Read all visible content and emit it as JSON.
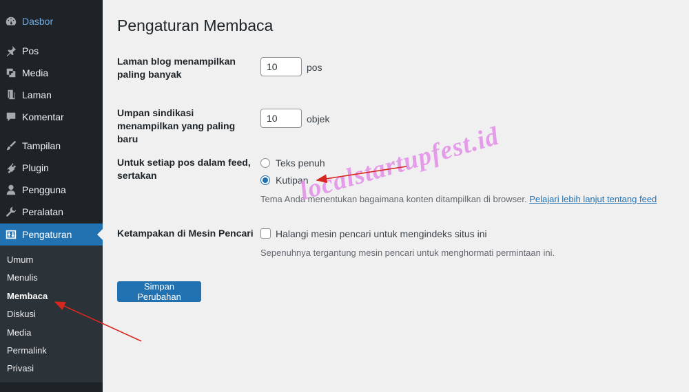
{
  "sidebar": {
    "items": [
      {
        "label": "Dasbor",
        "icon": "dashboard-icon"
      },
      {
        "label": "Pos",
        "icon": "pin-icon"
      },
      {
        "label": "Media",
        "icon": "media-icon"
      },
      {
        "label": "Laman",
        "icon": "page-icon"
      },
      {
        "label": "Komentar",
        "icon": "comment-icon"
      },
      {
        "label": "Tampilan",
        "icon": "brush-icon"
      },
      {
        "label": "Plugin",
        "icon": "plugin-icon"
      },
      {
        "label": "Pengguna",
        "icon": "user-icon"
      },
      {
        "label": "Peralatan",
        "icon": "wrench-icon"
      },
      {
        "label": "Pengaturan",
        "icon": "settings-icon"
      }
    ],
    "submenu": [
      "Umum",
      "Menulis",
      "Membaca",
      "Diskusi",
      "Media",
      "Permalink",
      "Privasi"
    ],
    "current_submenu": "Membaca"
  },
  "main": {
    "title": "Pengaturan Membaca",
    "blog_pages": {
      "label": "Laman blog menampilkan paling banyak",
      "value": "10",
      "unit": "pos"
    },
    "syndication": {
      "label": "Umpan sindikasi menampilkan yang paling baru",
      "value": "10",
      "unit": "objek"
    },
    "feed_content": {
      "label": "Untuk setiap pos dalam feed, sertakan",
      "options": [
        {
          "label": "Teks penuh",
          "checked": false
        },
        {
          "label": "Kutipan",
          "checked": true
        }
      ],
      "description": "Tema Anda menentukan bagaimana konten ditampilkan di browser.",
      "link": "Pelajari lebih lanjut tentang feed"
    },
    "search_engine": {
      "label": "Ketampakan di Mesin Pencari",
      "checkbox_label": "Halangi mesin pencari untuk mengindeks situs ini",
      "description": "Sepenuhnya tergantung mesin pencari untuk menghormati permintaan ini."
    },
    "save_label": "Simpan Perubahan"
  },
  "watermark": "localstartupfest.id",
  "colors": {
    "accent": "#2271b1",
    "sidebar": "#1d2327",
    "annotation_arrow": "#d7261e"
  }
}
